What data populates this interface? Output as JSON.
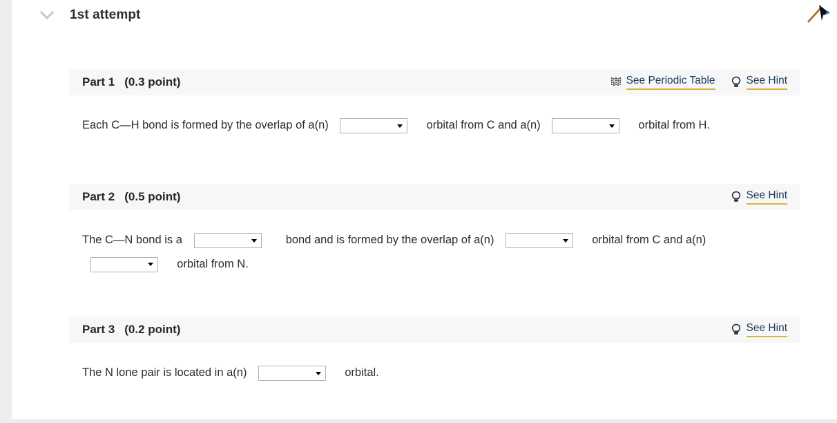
{
  "attempt": {
    "title": "1st attempt",
    "collapse_icon": "chevron-down-icon",
    "flag_icon": "flag-icon"
  },
  "links": {
    "periodic_table_label": "See Periodic Table",
    "hint_label": "See Hint",
    "periodic_icon": "periodic-table-icon",
    "hint_icon": "lightbulb-icon"
  },
  "colors": {
    "link_underline": "#d8b33a",
    "link_text": "#1b3a5c",
    "part_header_bg": "#f7f7f7",
    "page_bg": "#ededed",
    "card_bg": "#ffffff"
  },
  "parts": [
    {
      "label": "Part 1",
      "points": "(0.3 point)",
      "has_periodic_table_link": true,
      "has_hint_link": true,
      "text": {
        "seg1": "Each C—H bond is formed by the overlap of a(n)",
        "seg2": "orbital from C and a(n)",
        "seg3": "orbital from H."
      },
      "dropdowns": [
        {
          "name": "part1-orbital-c-select",
          "value": "",
          "options": [
            ""
          ]
        },
        {
          "name": "part1-orbital-h-select",
          "value": "",
          "options": [
            ""
          ]
        }
      ]
    },
    {
      "label": "Part 2",
      "points": "(0.5 point)",
      "has_periodic_table_link": false,
      "has_hint_link": true,
      "text": {
        "seg1": "The C—N bond is a",
        "seg2": "bond and is formed by the overlap of a(n)",
        "seg3": "orbital from C and a(n)",
        "seg4": "orbital from N."
      },
      "dropdowns": [
        {
          "name": "part2-bond-type-select",
          "value": "",
          "options": [
            ""
          ]
        },
        {
          "name": "part2-orbital-c-select",
          "value": "",
          "options": [
            ""
          ]
        },
        {
          "name": "part2-orbital-n-select",
          "value": "",
          "options": [
            ""
          ]
        }
      ]
    },
    {
      "label": "Part 3",
      "points": "(0.2 point)",
      "has_periodic_table_link": false,
      "has_hint_link": true,
      "text": {
        "seg1": "The N lone pair is located in a(n)",
        "seg2": "orbital."
      },
      "dropdowns": [
        {
          "name": "part3-lone-pair-orbital-select",
          "value": "",
          "options": [
            ""
          ]
        }
      ]
    }
  ]
}
